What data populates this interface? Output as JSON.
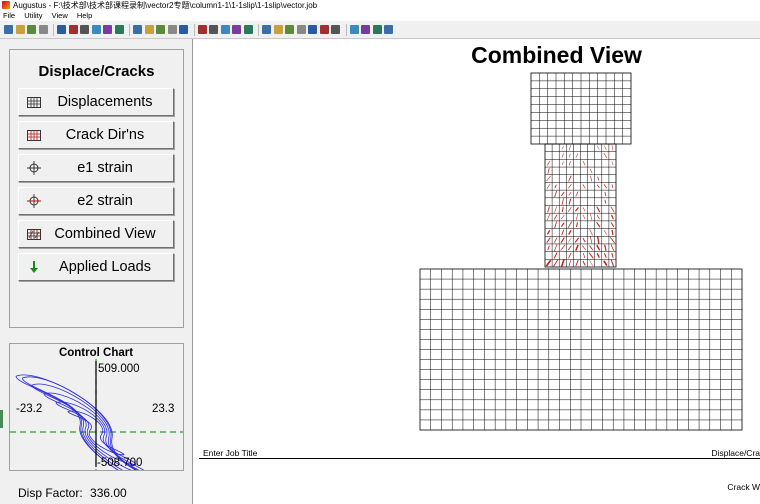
{
  "window": {
    "title": "Augustus - F:\\技术部\\技术部课程录制\\vector2专题\\column1-1\\1-1slip\\1-1slip\\vector.job"
  },
  "menu": [
    {
      "label": "File"
    },
    {
      "label": "Utility"
    },
    {
      "label": "View"
    },
    {
      "label": "Help"
    }
  ],
  "toolbar_icons": [
    "new-icon",
    "open-icon",
    "save-icon",
    "filter-icon",
    "frame-icon",
    "element-icon",
    "layer-icon",
    "scale-icon",
    "crack-icon",
    "chart-icon",
    "strain-x-icon",
    "strain-y-icon",
    "stress-icon",
    "stress-y-icon",
    "f-icon",
    "image-icon",
    "table-icon",
    "plot-icon",
    "flag-icon",
    "flag2-icon",
    "monitor-icon",
    "check-icon",
    "delete-icon",
    "zoom-icon",
    "tools-icon",
    "wrench-icon",
    "edit-icon",
    "stop-icon",
    "record-icon",
    "settings-icon",
    "export-icon"
  ],
  "left_panel": {
    "title": "Displace/Cracks",
    "buttons": [
      {
        "label": "Displacements",
        "icon": "mesh-icon"
      },
      {
        "label": "Crack Dir'ns",
        "icon": "crack-mesh-icon"
      },
      {
        "label": "e1 strain",
        "icon": "target-icon"
      },
      {
        "label": "e2 strain",
        "icon": "target-red-icon"
      },
      {
        "label": "Combined View",
        "icon": "combined-mesh-icon"
      },
      {
        "label": "Applied Loads",
        "icon": "load-arrow-icon"
      }
    ]
  },
  "control_chart": {
    "title": "Control Chart",
    "y_max_label": "509.000",
    "y_min_label": "-508.700",
    "x_min_label": "-23.2",
    "x_max_label": "23.3",
    "disp_factor_label": "Disp Factor:",
    "disp_factor_value": "336.00"
  },
  "view": {
    "title": "Combined View",
    "job_title": "Enter Job Title",
    "mode_label": "Displace/Cra",
    "footer_label": "Crack W"
  },
  "colors": {
    "crack": "#c0201a",
    "mesh": "#000000",
    "hysteresis": "#2a2ae0",
    "axis_dash": "#2a9a2a"
  }
}
